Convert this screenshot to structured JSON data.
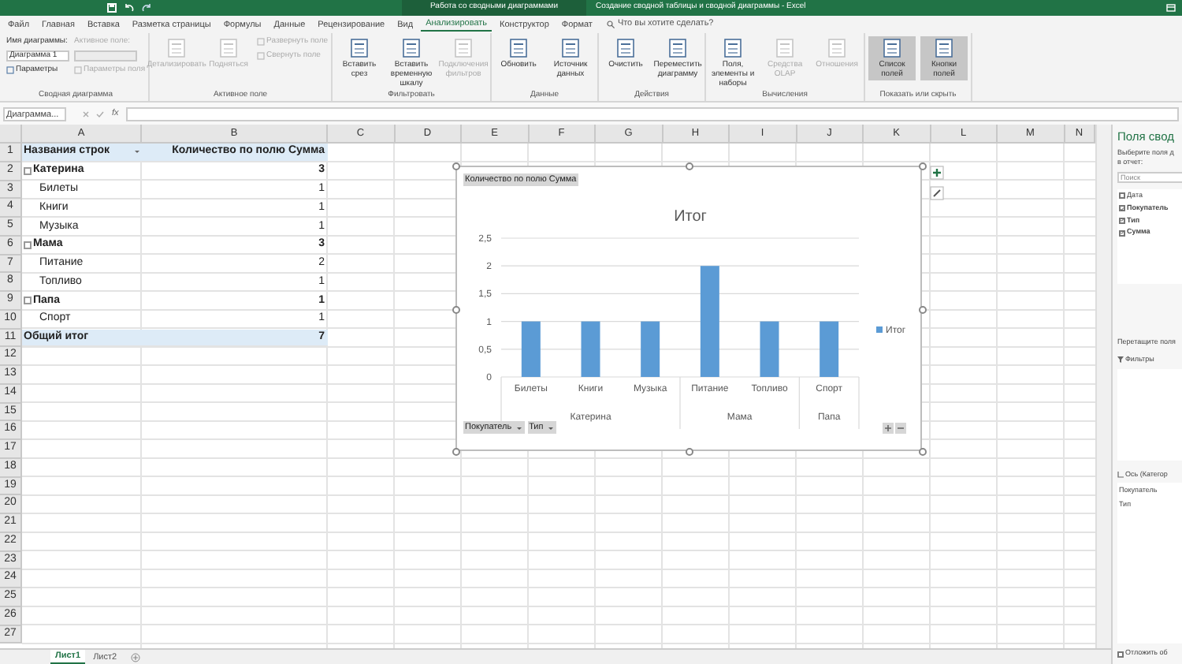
{
  "title_bar": {
    "context": "Работа со сводными диаграммами",
    "title": "Создание сводной таблицы и сводной диаграммы  -  Excel"
  },
  "tabs": [
    {
      "label": "Файл",
      "selected": false
    },
    {
      "label": "Главная",
      "selected": false
    },
    {
      "label": "Вставка",
      "selected": false
    },
    {
      "label": "Разметка страницы",
      "selected": false
    },
    {
      "label": "Формулы",
      "selected": false
    },
    {
      "label": "Данные",
      "selected": false
    },
    {
      "label": "Рецензирование",
      "selected": false
    },
    {
      "label": "Вид",
      "selected": false
    },
    {
      "label": "Анализировать",
      "selected": true
    },
    {
      "label": "Конструктор",
      "selected": false
    },
    {
      "label": "Формат",
      "selected": false
    }
  ],
  "search": {
    "placeholder": "Что вы хотите сделать?"
  },
  "ribbon_groups": [
    {
      "label": "Сводная диаграмма",
      "columns": [
        [
          {
            "kind": "text",
            "label": "Имя диаграммы:",
            "disabled": false
          },
          {
            "kind": "field",
            "value": "Диаграмма 1",
            "disabled": false
          },
          {
            "kind": "small",
            "label": "Параметры",
            "disabled": false
          }
        ],
        [
          {
            "kind": "text",
            "label": "Активное поле:",
            "disabled": true
          },
          {
            "kind": "field",
            "disabled": true
          },
          {
            "kind": "small",
            "label": "Параметры поля",
            "disabled": true
          }
        ]
      ]
    },
    {
      "label": "Активное поле",
      "columns": [
        [
          {
            "kind": "large",
            "label": "Детализировать",
            "disabled": true,
            "pressed": false
          }
        ],
        [
          {
            "kind": "large",
            "label": "Подняться",
            "disabled": true,
            "pressed": false
          }
        ],
        [
          {
            "kind": "small",
            "label": "Развернуть поле",
            "disabled": true
          },
          {
            "kind": "small",
            "label": "Свернуть поле",
            "disabled": true
          }
        ]
      ]
    },
    {
      "label": "Фильтровать",
      "columns": [
        [
          {
            "kind": "large",
            "label": "Вставить срез",
            "disabled": false,
            "pressed": false
          }
        ],
        [
          {
            "kind": "large",
            "label": "Вставить временную шкалу",
            "disabled": false,
            "pressed": false
          }
        ],
        [
          {
            "kind": "large",
            "label": "Подключения фильтров",
            "disabled": true,
            "pressed": false
          }
        ]
      ]
    },
    {
      "label": "Данные",
      "columns": [
        [
          {
            "kind": "large",
            "label": "Обновить",
            "disabled": false,
            "pressed": false
          }
        ],
        [
          {
            "kind": "large",
            "label": "Источник данных",
            "disabled": false,
            "pressed": false
          }
        ]
      ]
    },
    {
      "label": "Действия",
      "columns": [
        [
          {
            "kind": "large",
            "label": "Очистить",
            "disabled": false,
            "pressed": false
          }
        ],
        [
          {
            "kind": "large",
            "label": "Переместить диаграмму",
            "disabled": false,
            "pressed": false
          }
        ]
      ]
    },
    {
      "label": "Вычисления",
      "columns": [
        [
          {
            "kind": "large",
            "label": "Поля, элементы и наборы",
            "disabled": false,
            "pressed": false
          }
        ],
        [
          {
            "kind": "large",
            "label": "Средства OLAP",
            "disabled": true,
            "pressed": false
          }
        ],
        [
          {
            "kind": "large",
            "label": "Отношения",
            "disabled": true,
            "pressed": false
          }
        ]
      ]
    },
    {
      "label": "Показать или скрыть",
      "columns": [
        [
          {
            "kind": "large",
            "label": "Список полей",
            "disabled": false,
            "pressed": true
          }
        ],
        [
          {
            "kind": "large",
            "label": "Кнопки полей",
            "disabled": false,
            "pressed": true
          }
        ]
      ]
    }
  ],
  "formula_bar": {
    "name_box": "Диаграмма...",
    "function_button": "fx"
  },
  "sheet": {
    "columns": [
      "A",
      "B",
      "C",
      "D",
      "E",
      "F",
      "G",
      "H",
      "I",
      "J",
      "K",
      "L",
      "M",
      "N"
    ],
    "rows": [
      "1",
      "2",
      "3",
      "4",
      "5",
      "6",
      "7",
      "8",
      "9",
      "10",
      "11",
      "12",
      "13",
      "14",
      "15",
      "16",
      "17",
      "18",
      "19",
      "20",
      "21",
      "22",
      "23",
      "24",
      "25",
      "26",
      "27"
    ]
  },
  "pivot": [
    {
      "kind": "header",
      "label": "Названия строк",
      "value": "Количество по полю Сумма"
    },
    {
      "kind": "group",
      "label": "Катерина",
      "value": "3",
      "expanded": true
    },
    {
      "kind": "item",
      "label": "Билеты",
      "value": "1"
    },
    {
      "kind": "item",
      "label": "Книги",
      "value": "1"
    },
    {
      "kind": "item",
      "label": "Музыка",
      "value": "1"
    },
    {
      "kind": "group",
      "label": "Мама",
      "value": "3",
      "expanded": true
    },
    {
      "kind": "item",
      "label": "Питание",
      "value": "2"
    },
    {
      "kind": "item",
      "label": "Топливо",
      "value": "1"
    },
    {
      "kind": "group",
      "label": "Папа",
      "value": "1",
      "expanded": true
    },
    {
      "kind": "item",
      "label": "Спорт",
      "value": "1"
    },
    {
      "kind": "total",
      "label": "Общий итог",
      "value": "7"
    }
  ],
  "chart": {
    "value_button": "Количество по полю Сумма",
    "axis_buttons": [
      "Покупатель",
      "Тип"
    ],
    "chart_data": {
      "type": "bar",
      "title": "Итог",
      "categories": [
        "Билеты",
        "Книги",
        "Музыка",
        "Питание",
        "Топливо",
        "Спорт"
      ],
      "grid": true,
      "annotations": [
        "Катерина",
        "Мама",
        "Папа"
      ],
      "series": [
        {
          "name": "Итог",
          "color": "#5b9bd5",
          "values": [
            1,
            1,
            1,
            2,
            1,
            1
          ]
        }
      ],
      "ylim": [
        0,
        2.5
      ],
      "yticks": [
        0,
        {
          "value": 0.5,
          "label": "0,5"
        },
        1,
        {
          "value": 1.5,
          "label": "1,5"
        },
        2,
        {
          "value": 2.5,
          "label": "2,5"
        }
      ]
    }
  },
  "field_pane": {
    "title": "Поля свод",
    "hint_lines": [
      "Выберите поля д",
      "в отчет:"
    ],
    "search_placeholder": "Поиск",
    "fields": [
      {
        "label": "Дата",
        "checked": false
      },
      {
        "label": "Покупатель",
        "checked": true
      },
      {
        "label": "Тип",
        "checked": true
      },
      {
        "label": "Сумма",
        "checked": true
      }
    ],
    "drag_hint": "Перетащите поля",
    "filters_label": "Фильтры",
    "axis_label": "Ось (Категор",
    "axis_items": [
      "Покупатель",
      "Тип"
    ],
    "defer": {
      "label": "Отложить об",
      "checked": false
    }
  },
  "sheet_tabs": [
    {
      "label": "Лист1",
      "selected": true
    },
    {
      "label": "Лист2",
      "selected": false
    }
  ]
}
